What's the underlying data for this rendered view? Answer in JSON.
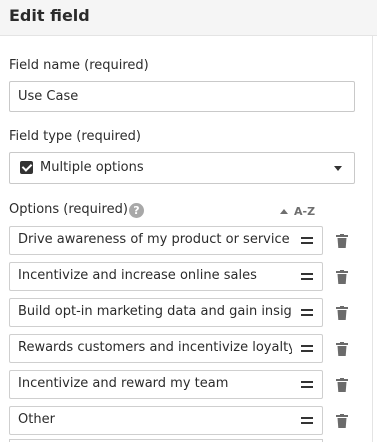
{
  "header": {
    "title": "Edit field"
  },
  "field_name": {
    "label": "Field name (required)",
    "value": "Use Case"
  },
  "field_type": {
    "label": "Field type (required)",
    "selected": "Multiple options",
    "icon": "checkbox-icon"
  },
  "options": {
    "label": "Options (required)",
    "help": "?",
    "sort_label": "A-Z",
    "items": [
      {
        "label": "Drive awareness of my product or service"
      },
      {
        "label": "Incentivize and increase online sales"
      },
      {
        "label": "Build opt-in marketing data and gain insights"
      },
      {
        "label": "Rewards customers and incentivize loyalty"
      },
      {
        "label": "Incentivize and reward my team"
      },
      {
        "label": "Other"
      }
    ]
  },
  "colors": {
    "header_bg": "#f5f5f5",
    "border": "#c9c9c9",
    "text": "#2b2b2b",
    "icon": "#333333",
    "muted": "#6f6f6f"
  }
}
